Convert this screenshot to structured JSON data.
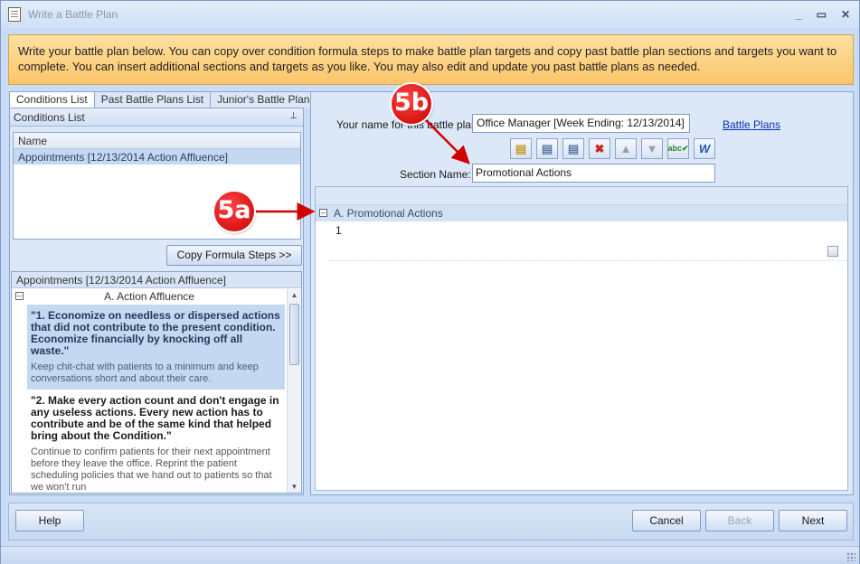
{
  "window": {
    "title": "Write a Battle Plan",
    "controls": {
      "minimize": "_",
      "maximize": "▭",
      "close": "✕"
    }
  },
  "banner": {
    "text": "Write your battle plan below. You can copy over condition formula steps to make battle plan targets and copy past battle plan sections and targets you want to complete. You can insert additional sections and targets as you like. You may also edit and update you past battle plans as needed."
  },
  "left": {
    "tabs": [
      "Conditions List",
      "Past Battle Plans List",
      "Junior's Battle Plans"
    ],
    "panel_title": "Conditions List",
    "column_header": "Name",
    "rows": [
      "Appointments [12/13/2014 Action Affluence]"
    ],
    "copy_button": "Copy Formula Steps >>",
    "detail": {
      "header": "Appointments [12/13/2014 Action Affluence]",
      "section": "A. Action Affluence",
      "steps": [
        {
          "title": "\"1. Economize on needless or dispersed actions that did not contribute to the present condition. Economize financially by knocking off all waste.\"",
          "note": "Keep chit-chat with patients to a minimum and keep conversations short and about their care."
        },
        {
          "title": "\"2. Make every action count and don't engage in any useless actions. Every new action has to contribute and be of the same kind that helped bring about the Condition.\"",
          "note": "Continue to confirm patients for their next appointment before they leave the office. Reprint the patient scheduling policies that we hand out to patients so that we won't run"
        }
      ]
    }
  },
  "right": {
    "name_label": "Your name for this battle plan:",
    "name_value": "Office Manager [Week Ending: 12/13/2014]",
    "battle_plans_link": "Battle Plans",
    "section_label": "Section Name:",
    "section_value": "Promotional Actions",
    "grid": {
      "section_title": "A. Promotional Actions",
      "target_number": "1"
    },
    "toolbar": [
      "insert-section-icon",
      "insert-target-above-icon",
      "insert-target-below-icon",
      "delete-icon",
      "move-up-icon",
      "move-down-icon",
      "spell-check-icon",
      "word-export-icon"
    ]
  },
  "footer": {
    "help": "Help",
    "cancel": "Cancel",
    "back": "Back",
    "next": "Next"
  },
  "callouts": {
    "a": "5a",
    "b": "5b"
  },
  "colors": {
    "banner": "#fbc56a",
    "callout": "#d10000",
    "link": "#0a33b8",
    "selection": "#c5d8f2"
  }
}
